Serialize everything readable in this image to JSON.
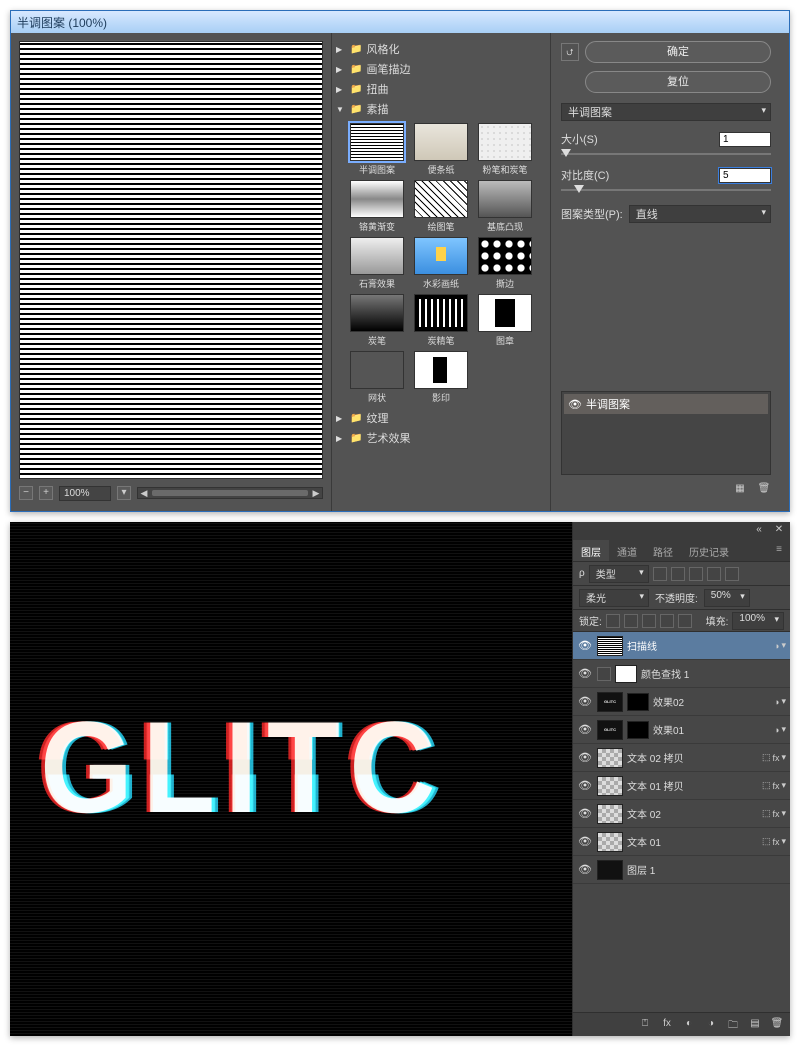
{
  "win": {
    "title": "半调图案 (100%)",
    "zoom": "100%",
    "categories": {
      "stylize": "风格化",
      "brush": "画笔描边",
      "distort": "扭曲",
      "sketch": "素描",
      "texture": "纹理",
      "artistic": "艺术效果"
    },
    "filters": {
      "halftone": "半调图案",
      "notepaper": "便条纸",
      "chalk": "粉笔和炭笔",
      "chrome": "铬黄渐变",
      "graphic": "绘图笔",
      "basrelief": "基底凸现",
      "plaster": "石膏效果",
      "waterpaper": "水彩画纸",
      "torn": "撕边",
      "charcoal": "炭笔",
      "conte": "炭精笔",
      "stamp": "图章",
      "reticulate": "网状",
      "photocopy": "影印"
    },
    "opts": {
      "ok": "确定",
      "cancel": "复位",
      "filterSelect": "半调图案",
      "sizeLabel": "大小(S)",
      "sizeVal": "1",
      "contrastLabel": "对比度(C)",
      "contrastVal": "5",
      "patternTypeLabel": "图案类型(P):",
      "patternTypeVal": "直线",
      "applied": "半调图案"
    }
  },
  "canvas": {
    "glitchText": "GLITC"
  },
  "panel": {
    "tabs": {
      "layers": "图层",
      "channels": "通道",
      "paths": "路径",
      "history": "历史记录"
    },
    "kind_prefix": "ρ",
    "kind": "类型",
    "blendMode": "柔光",
    "opacityLabel": "不透明度:",
    "opacityVal": "50%",
    "lockLabel": "锁定:",
    "fillLabel": "填充:",
    "fillVal": "100%",
    "layers": {
      "scanlines": "扫描线",
      "colorlookup": "颜色查找 1",
      "fx02": "效果02",
      "fx01": "效果01",
      "copy02": "文本 02 拷贝",
      "copy01": "文本 01 拷贝",
      "text02": "文本 02",
      "text01": "文本 01",
      "layer1": "图层 1"
    },
    "fxGlyph": "fx"
  }
}
